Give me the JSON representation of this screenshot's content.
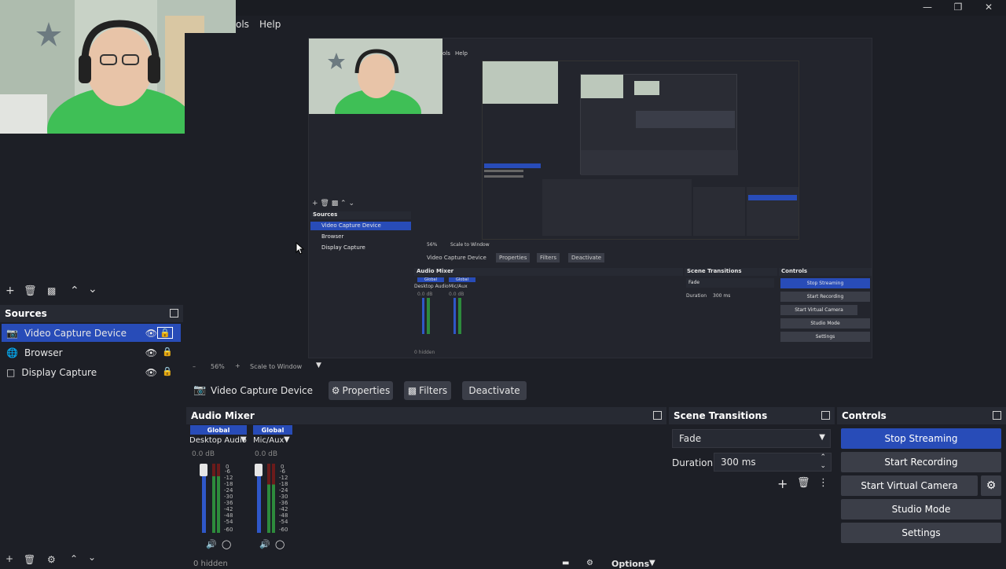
{
  "window": {
    "minimize": "—",
    "restore": "❐",
    "close": "✕"
  },
  "menu": {
    "tools": "ols",
    "help": "Help"
  },
  "nested_preview": {
    "menu_tools": "ols",
    "menu_help": "Help",
    "sources_title": "Sources",
    "sources": [
      "Video Capture Device",
      "Browser",
      "Display Capture"
    ],
    "zoom": "56%",
    "scale": "Scale to Window",
    "context_source": "Video Capture Device",
    "properties": "Properties",
    "filters": "Filters",
    "deactivate": "Deactivate",
    "audio_mixer": "Audio Mixer",
    "global": "Global",
    "desktop_audio": "Desktop Audio",
    "mic_aux": "Mic/Aux",
    "db": "0.0 dB",
    "scene_transitions": "Scene Transitions",
    "fade": "Fade",
    "duration_label": "Duration",
    "duration_value": "300 ms",
    "controls": "Controls",
    "stop_streaming": "Stop Streaming",
    "start_recording": "Start Recording",
    "start_virtual_camera": "Start Virtual Camera",
    "studio_mode": "Studio Mode",
    "settings": "Settings",
    "hidden": "0 hidden",
    "options": "Options"
  },
  "sources_panel": {
    "title": "Sources",
    "items": [
      {
        "label": "Video Capture Device",
        "selected": true,
        "icon": "camera-icon"
      },
      {
        "label": "Browser",
        "selected": false,
        "icon": "globe-icon"
      },
      {
        "label": "Display Capture",
        "selected": false,
        "icon": "monitor-icon"
      }
    ]
  },
  "preview_bar": {
    "minus": "–",
    "zoom": "56%",
    "plus": "+",
    "scale": "Scale to Window"
  },
  "context_bar": {
    "source": "Video Capture Device",
    "properties": "Properties",
    "filters": "Filters",
    "deactivate": "Deactivate"
  },
  "audio_mixer": {
    "title": "Audio Mixer",
    "channels": [
      {
        "global": "Global",
        "name": "Desktop Audio",
        "db": "0.0 dB"
      },
      {
        "global": "Global",
        "name": "Mic/Aux",
        "db": "0.0 dB"
      }
    ],
    "scale": [
      "0",
      "-6",
      "-12",
      "-18",
      "-24",
      "-30",
      "-36",
      "-42",
      "-48",
      "-54",
      "-60"
    ],
    "hidden": "0 hidden",
    "options": "Options"
  },
  "scene_transitions": {
    "title": "Scene Transitions",
    "transition": "Fade",
    "duration_label": "Duration",
    "duration_value": "300 ms"
  },
  "controls": {
    "title": "Controls",
    "stop_streaming": "Stop Streaming",
    "start_recording": "Start Recording",
    "start_virtual_camera": "Start Virtual Camera",
    "studio_mode": "Studio Mode",
    "settings": "Settings"
  },
  "colors": {
    "accent": "#284cb8",
    "panel": "#272a33",
    "bg": "#1d1f26"
  }
}
